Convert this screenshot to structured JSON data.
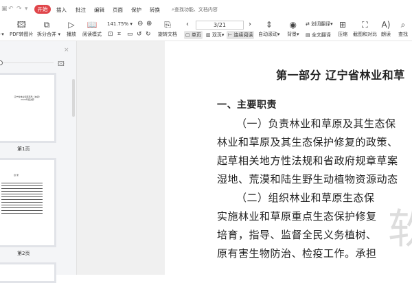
{
  "menu": {
    "start": "开始",
    "tabs": [
      "插入",
      "批注",
      "编辑",
      "页面",
      "保护",
      "转换"
    ],
    "search_placeholder": "查找功能、文档内容"
  },
  "toolbar": {
    "pdf_to_image": "PDF转图片",
    "split_merge": "拆分合并",
    "play": "播放",
    "read_mode": "阅读模式",
    "zoom": "141.75%",
    "rotate": "旋转文档",
    "single": "单页",
    "double": "双页",
    "continuous": "连续阅读",
    "page": "3/21",
    "auto_scroll": "自动滚动",
    "background": "背景",
    "word_translate": "划词翻译",
    "full_translate": "全文翻译",
    "compress": "压缩",
    "screenshot_compare": "截图和对比",
    "read_aloud": "朗读",
    "find": "查找"
  },
  "sidebar": {
    "thumbs": [
      {
        "label": "第1页",
        "title": "辽宁省林业和草原局（本级）",
        "subtitle": "2020年度决算"
      },
      {
        "label": "第2页",
        "title": "目 录"
      }
    ]
  },
  "document": {
    "title": "第一部分  辽宁省林业和草",
    "heading": "一、主要职责",
    "lines": [
      "（一）负责林业和草原及其生态保",
      "林业和草原及其生态保护修复的政策、",
      "起草相关地方性法规和省政府规章草案",
      "湿地、荒漠和陆生野生动植物资源动态",
      "（二）组织林业和草原生态保",
      "实施林业和草原重点生态保护修复",
      "培育，指导、监督全民义务植树、",
      "原有害生物防治、检疫工作。承担"
    ],
    "watermark": "软"
  }
}
